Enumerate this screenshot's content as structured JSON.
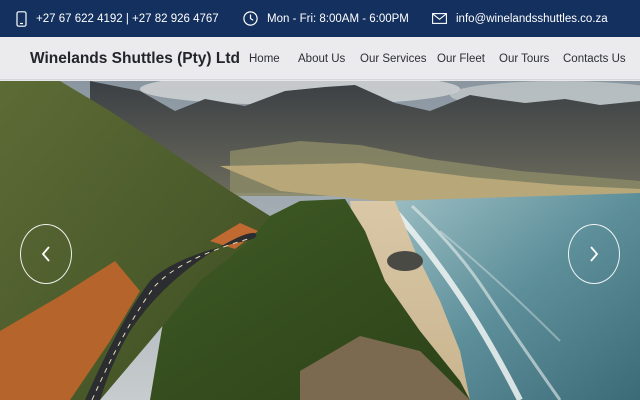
{
  "topbar": {
    "phone": "+27 67 622 4192 | +27 82 926 4767",
    "hours": "Mon - Fri: 8:00AM - 6:00PM",
    "email": "info@winelandsshuttles.co.za"
  },
  "navbar": {
    "brand": "Winelands Shuttles (Pty) Ltd",
    "links": [
      "Home",
      "About Us",
      "Our Services",
      "Our Fleet",
      "Our Tours",
      "Contacts Us"
    ]
  },
  "hero": {
    "image_description": "coastal mountain road beside the ocean",
    "prev_icon": "chevron-left-icon",
    "next_icon": "chevron-right-icon"
  },
  "colors": {
    "topbar_bg": "#13305e",
    "navbar_bg": "#ebebed",
    "brand_text": "#23252b"
  }
}
